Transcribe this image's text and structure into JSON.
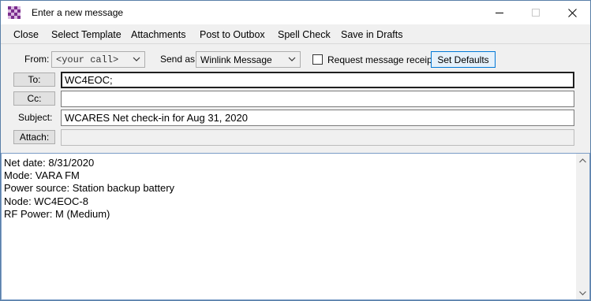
{
  "window": {
    "title": "Enter a new message",
    "controls": {
      "minimize_icon": "minimize-icon",
      "maximize_icon": "maximize-icon",
      "close_icon": "close-icon"
    }
  },
  "menu": {
    "items": [
      "Close",
      "Select Template",
      "Attachments",
      "Post to Outbox",
      "Spell Check",
      "Save in Drafts"
    ]
  },
  "header": {
    "from_label": "From:",
    "from_value": "<your call>",
    "send_as_label": "Send as:",
    "send_as_value": "Winlink Message",
    "request_receipt_label": "Request message receipt",
    "request_receipt_checked": false,
    "set_defaults_label": "Set Defaults",
    "to_button": "To:",
    "to_value": "WC4EOC;",
    "cc_button": "Cc:",
    "cc_value": "",
    "subject_label": "Subject:",
    "subject_value": "WCARES Net check-in for Aug 31, 2020",
    "attach_button": "Attach:",
    "attach_value": ""
  },
  "message_body": "Net date: 8/31/2020\nMode: VARA FM\nPower source: Station backup battery\nNode: WC4EOC-8\nRF Power: M (Medium)",
  "colors": {
    "accent": "#0078d7",
    "icon_purple": "#7b2d8e",
    "window_border": "#5a7fa8"
  }
}
